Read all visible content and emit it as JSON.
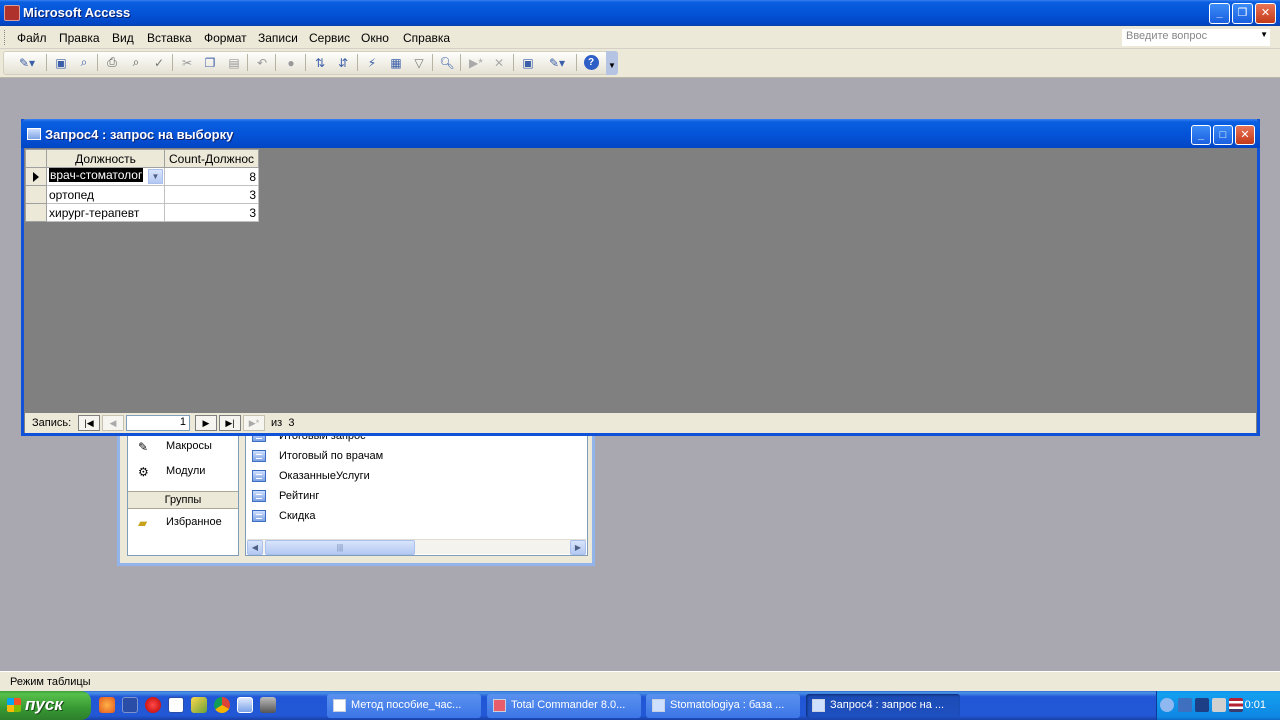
{
  "app": {
    "title": "Microsoft Access",
    "window_controls": {
      "minimize": "_",
      "restore": "❐",
      "close": "✕"
    }
  },
  "menu": {
    "items": [
      "Файл",
      "Правка",
      "Вид",
      "Вставка",
      "Формат",
      "Записи",
      "Сервис",
      "Окно",
      "Справка"
    ],
    "ask_placeholder": "Введите вопрос"
  },
  "toolbar": {
    "icons": [
      "view-icon",
      "save-icon",
      "search-file-icon",
      "print-icon",
      "print-preview-icon",
      "spelling-icon",
      "cut-icon",
      "copy-icon",
      "paste-icon",
      "undo-icon",
      "insert-hyperlink-icon",
      "sort-ascending-icon",
      "sort-descending-icon",
      "filter-by-selection-icon",
      "filter-by-form-icon",
      "apply-filter-icon",
      "find-icon",
      "new-record-icon",
      "delete-record-icon",
      "database-window-icon",
      "new-object-icon",
      "help-icon"
    ]
  },
  "query_window": {
    "title": "Запрос4 : запрос на выборку",
    "columns": [
      "Должность",
      "Count-Должнос"
    ],
    "rows": [
      {
        "position": "врач-стоматолог",
        "count": "8"
      },
      {
        "position": "ортопед",
        "count": "3"
      },
      {
        "position": "хирург-терапевт",
        "count": "3"
      }
    ],
    "nav": {
      "label": "Запись:",
      "current": "1",
      "of_label": "из",
      "total": "3"
    }
  },
  "database_window": {
    "left_items": [
      {
        "label": "Макросы",
        "icon": "macro-icon"
      },
      {
        "label": "Модули",
        "icon": "module-icon"
      }
    ],
    "groups_header": "Группы",
    "favorites": "Избранное",
    "objects": [
      {
        "label": "Итоговый запрос",
        "icon": "query-icon"
      },
      {
        "label": "Итоговый по врачам",
        "icon": "query-icon"
      },
      {
        "label": "ОказанныеУслуги",
        "icon": "query-icon"
      },
      {
        "label": "Рейтинг",
        "icon": "query-icon"
      },
      {
        "label": "Скидка",
        "icon": "query-icon"
      }
    ]
  },
  "status_bar": {
    "text": "Режим таблицы"
  },
  "taskbar": {
    "start_label": "пуск",
    "tasks": [
      {
        "label": "Метод пособие_час...",
        "active": false
      },
      {
        "label": "Total Commander 8.0...",
        "active": false
      },
      {
        "label": "Stomatologiya : база ...",
        "active": false
      },
      {
        "label": "Запрос4 : запрос на ...",
        "active": true
      }
    ],
    "clock": "0:01"
  },
  "colors": {
    "titlebar_blue": "#0453d8",
    "workspace_gray": "#a9a8b0",
    "datasheet_bg": "#808080",
    "xp_green": "#379833"
  }
}
